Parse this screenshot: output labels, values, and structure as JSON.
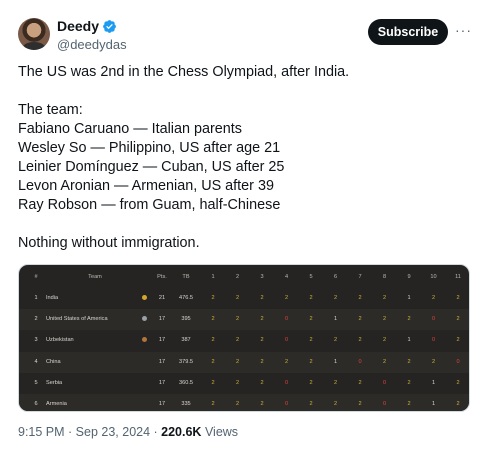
{
  "author": {
    "display_name": "Deedy",
    "handle": "@deedydas",
    "avatar_icon": "avatar",
    "verified_color": "#1d9bf0"
  },
  "actions": {
    "subscribe_label": "Subscribe",
    "more_label": "···"
  },
  "tweet": {
    "lines": [
      "The US was 2nd in the Chess Olympiad, after India.",
      "",
      "The team:",
      "Fabiano Caruano — Italian parents",
      "Wesley So — Philippino, US after age 21",
      "Leinier Domínguez — Cuban, US after 25",
      "Levon Aronian — Armenian, US after 39",
      "Ray Robson — from Guam, half-Chinese",
      "",
      "Nothing without immigration."
    ]
  },
  "standings": {
    "headers": {
      "rank": "#",
      "team": "Team",
      "pts": "Pts.",
      "tb": "TB",
      "rounds": [
        "1",
        "2",
        "3",
        "4",
        "5",
        "6",
        "7",
        "8",
        "9",
        "10",
        "11"
      ]
    },
    "rows": [
      {
        "rank": "1",
        "team": "India",
        "medal": "gold",
        "pts": "21",
        "tb": "476.5",
        "results": [
          "2",
          "2",
          "2",
          "2",
          "2",
          "2",
          "2",
          "2",
          "1",
          "2",
          "2"
        ]
      },
      {
        "rank": "2",
        "team": "United States of America",
        "medal": "silver",
        "pts": "17",
        "tb": "395",
        "results": [
          "2",
          "2",
          "2",
          "0",
          "2",
          "1",
          "2",
          "2",
          "2",
          "0",
          "2"
        ]
      },
      {
        "rank": "3",
        "team": "Uzbekistan",
        "medal": "bronze",
        "pts": "17",
        "tb": "387",
        "results": [
          "2",
          "2",
          "2",
          "0",
          "2",
          "2",
          "2",
          "2",
          "1",
          "0",
          "2"
        ]
      },
      {
        "rank": "4",
        "team": "China",
        "medal": "",
        "pts": "17",
        "tb": "379.5",
        "results": [
          "2",
          "2",
          "2",
          "2",
          "2",
          "1",
          "0",
          "2",
          "2",
          "2",
          "0"
        ]
      },
      {
        "rank": "5",
        "team": "Serbia",
        "medal": "",
        "pts": "17",
        "tb": "360.5",
        "results": [
          "2",
          "2",
          "2",
          "0",
          "2",
          "2",
          "2",
          "0",
          "2",
          "1",
          "2"
        ]
      },
      {
        "rank": "6",
        "team": "Armenia",
        "medal": "",
        "pts": "17",
        "tb": "335",
        "results": [
          "2",
          "2",
          "2",
          "0",
          "2",
          "2",
          "2",
          "0",
          "2",
          "1",
          "2"
        ]
      }
    ],
    "colors": {
      "win": "#c9b03a",
      "draw": "#d9d6d2",
      "loss": "#e0413a",
      "gold": "#d4a72c",
      "silver": "#9aa0a6",
      "bronze": "#b0753a"
    }
  },
  "meta": {
    "time": "9:15 PM",
    "separator": " · ",
    "date": "Sep 23, 2024",
    "views_count": "220.6K",
    "views_label": " Views"
  }
}
